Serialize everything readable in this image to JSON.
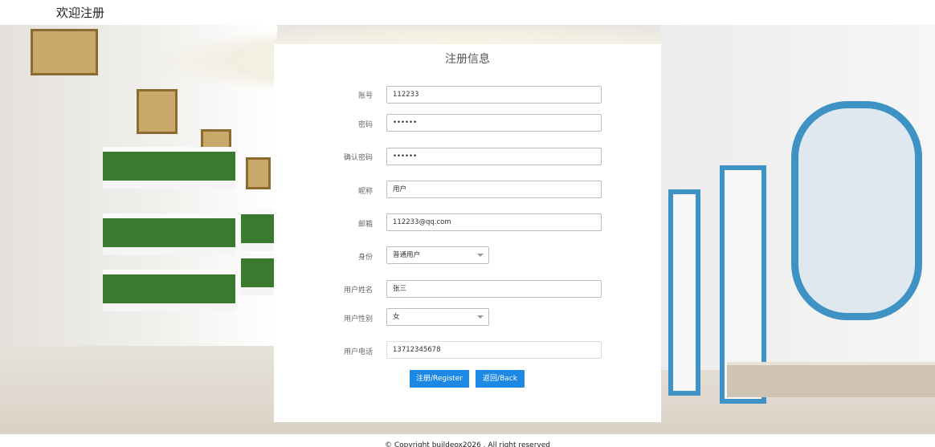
{
  "header": {
    "title": "欢迎注册"
  },
  "form": {
    "title": "注册信息",
    "fields": [
      {
        "label": "账号",
        "value": "112233"
      },
      {
        "label": "密码",
        "value": "••••••"
      },
      {
        "label": "确认密码",
        "value": "••••••"
      },
      {
        "label": "昵称",
        "value": "用户"
      },
      {
        "label": "邮箱",
        "value": "112233@qq.com"
      },
      {
        "label": "身份",
        "value": "普通用户"
      },
      {
        "label": "用户姓名",
        "value": "张三"
      },
      {
        "label": "用户性别",
        "value": "女"
      },
      {
        "label": "用户电话",
        "value": "13712345678"
      }
    ],
    "register_label": "注册/Register",
    "back_label": "返回/Back"
  },
  "footer": {
    "text": "© Copyright buildeox2026 . All right reserved"
  },
  "colors": {
    "button": "#1e88e5",
    "accent_blue": "#3e92c4"
  }
}
